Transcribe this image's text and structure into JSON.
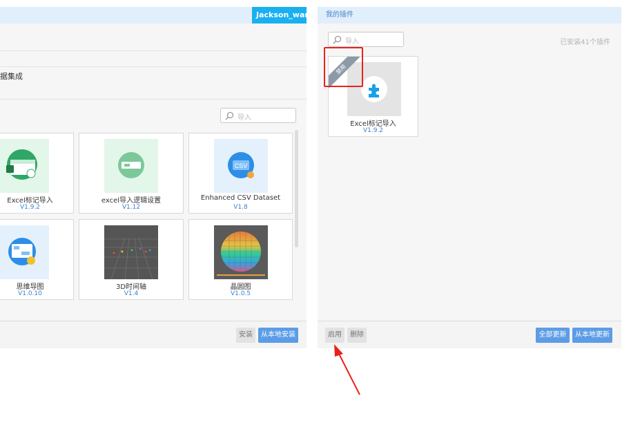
{
  "left_panel": {
    "user_name": "Jackson_wang",
    "section_text": "据集成",
    "search_placeholder": "导入",
    "plugins": [
      {
        "name": "Excel标记导入",
        "version": "V1.9.2",
        "icon": "excel-import-icon"
      },
      {
        "name": "excel导入逻辑设置",
        "version": "V1.12",
        "icon": "excel-logic-icon"
      },
      {
        "name": "Enhanced CSV Dataset",
        "version": "V1.8",
        "icon": "csv-icon"
      },
      {
        "name": "思维导图",
        "version": "V1.0.10",
        "icon": "mindmap-icon"
      },
      {
        "name": "3D时间轴",
        "version": "V1.4",
        "icon": "timeline-3d-icon"
      },
      {
        "name": "晶圆图",
        "version": "V1.0.5",
        "icon": "wafer-map-icon"
      }
    ],
    "install_label": "安装",
    "local_install_label": "从本地安装"
  },
  "right_panel": {
    "title": "我的插件",
    "search_placeholder": "导入",
    "installed_count": "已安装41个插件",
    "plugin": {
      "name": "Excel标记导入",
      "version": "V1.9.2",
      "badge": "禁用",
      "icon": "puzzle-icon"
    },
    "enable_label": "启用",
    "delete_label": "删除",
    "update_all_label": "全部更新",
    "local_update_label": "从本地更新"
  },
  "colors": {
    "accent": "#5c9ce6",
    "user_bg": "#1ab0f0",
    "header_bg": "#e1eefb",
    "highlight": "#e8221b"
  }
}
